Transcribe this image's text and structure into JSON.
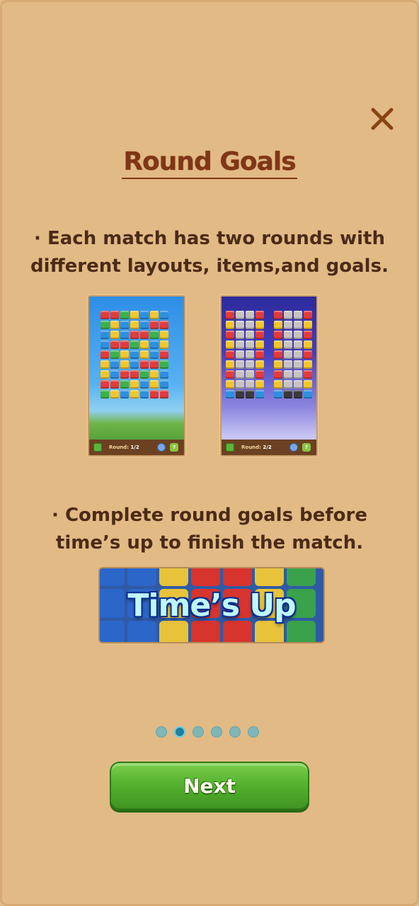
{
  "dialog": {
    "title": "Round Goals",
    "text1": "· Each match has two rounds with different layouts, items,and goals.",
    "text2": "· Complete round goals before time’s up to finish the match.",
    "banner_text": "Time’s Up",
    "next_label": "Next"
  },
  "screens": [
    {
      "round_label": "Round:",
      "round_value": "1/2",
      "help": "?"
    },
    {
      "round_label": "Round:",
      "round_value": "2/2",
      "help": "?"
    }
  ],
  "pagination": {
    "total": 6,
    "active_index": 1
  },
  "icons": {
    "close": "close-icon"
  },
  "colors": {
    "background": "#e2ba85",
    "title": "#7f3617",
    "text": "#4b2b17",
    "button_green": "#56b330",
    "dot_active": "#1f7f9d",
    "dot_inactive": "#7fb6b7"
  }
}
